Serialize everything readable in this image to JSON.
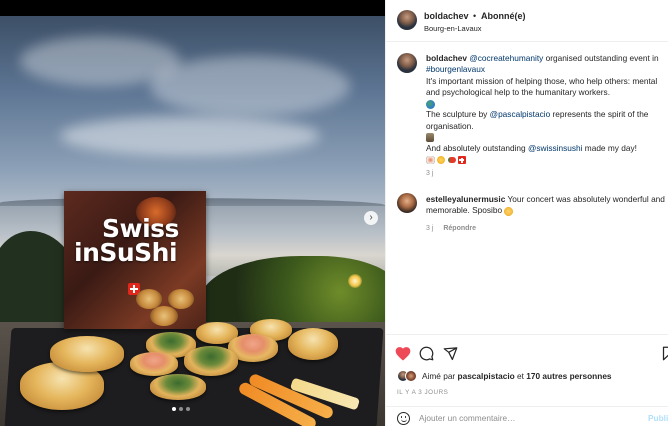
{
  "post": {
    "media_alt": "Swiss in Sushi cookbook and sushi platter by Lake Geneva at dusk",
    "book_title_line1": "Swiss",
    "book_title_line2": "inSuShi",
    "carousel": {
      "total_slides": 3,
      "active_slide": 1
    }
  },
  "header": {
    "username": "boldachev",
    "separator": "•",
    "follow_status": "Abonné(e)",
    "location": "Bourg-en-Lavaux"
  },
  "caption": {
    "username": "boldachev",
    "mention1": "@cocreatehumanity",
    "text1": " organised outstanding event in ",
    "hashtag": "#bourgenlavaux",
    "text2": "It's important mission of helping those, who help others: mental and psychological help to the humanitary workers.",
    "text3_prefix": "The sculpture by ",
    "mention2": "@pascalpistacio",
    "text3_suffix": " represents the spirit of the organisation.",
    "text4_prefix": "And absolutely outstanding ",
    "mention3": "@swissinsushi",
    "text4_suffix": " made my day!",
    "time": "3 j",
    "emojis": [
      "globe-emoji",
      "statue-emoji",
      "sushi-emoji",
      "sparkle-emoji",
      "chili-emoji",
      "swiss-flag-emoji"
    ]
  },
  "comment": {
    "username": "estelleyalunermusic",
    "text": " Your concert was absolutely wonderful and memorable. Sposibo ",
    "time": "3 j",
    "reply_label": "Répondre"
  },
  "actions": {
    "liked": true,
    "like_color": "#ed4956"
  },
  "likes": {
    "prefix": "Aimé par ",
    "user": "pascalpistacio",
    "middle": " et ",
    "others": "170 autres personnes"
  },
  "posted_ago": "IL Y A 3 JOURS",
  "add_comment": {
    "placeholder": "Ajouter un commentaire…",
    "publish_label": "Publi"
  }
}
